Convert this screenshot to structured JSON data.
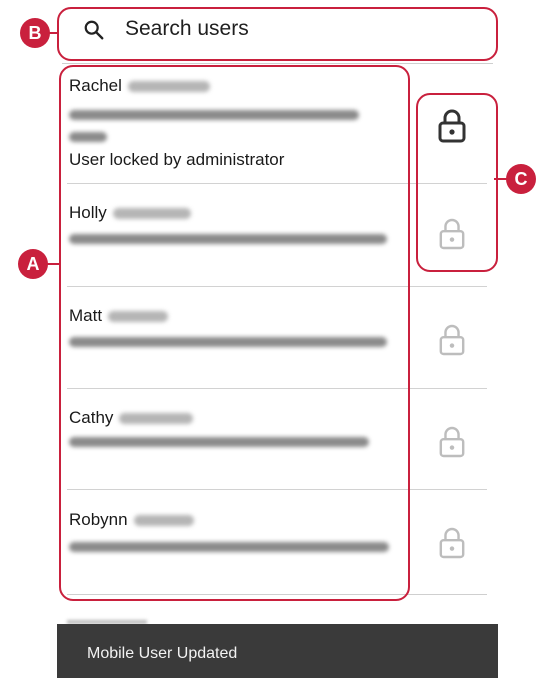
{
  "search": {
    "placeholder": "Search users"
  },
  "users": [
    {
      "first_name": "Rachel",
      "status": "User locked by administrator",
      "locked": true
    },
    {
      "first_name": "Holly",
      "status": "",
      "locked": false
    },
    {
      "first_name": "Matt",
      "status": "",
      "locked": false
    },
    {
      "first_name": "Cathy",
      "status": "",
      "locked": false
    },
    {
      "first_name": "Robynn",
      "status": "",
      "locked": false
    }
  ],
  "toast": {
    "message": "Mobile User Updated"
  },
  "callouts": {
    "a": "A",
    "b": "B",
    "c": "C"
  },
  "colors": {
    "callout": "#c9203d",
    "lock_locked": "#333333",
    "lock_unlocked": "#bdbdbd",
    "toast_bg": "#3a3a3a"
  },
  "icons": {
    "search": "search-icon",
    "lock": "lock-icon"
  }
}
